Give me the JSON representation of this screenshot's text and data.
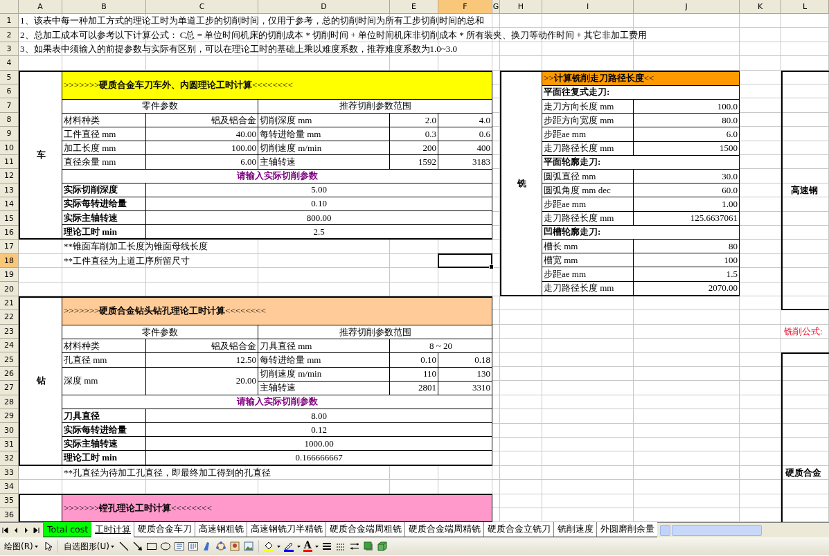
{
  "columns": [
    {
      "label": "A",
      "selected": false
    },
    {
      "label": "B",
      "selected": false
    },
    {
      "label": "C",
      "selected": false
    },
    {
      "label": "D",
      "selected": false
    },
    {
      "label": "E",
      "selected": false
    },
    {
      "label": "F",
      "selected": true
    },
    {
      "label": "G",
      "selected": false
    },
    {
      "label": "H",
      "selected": false
    },
    {
      "label": "I",
      "selected": false
    },
    {
      "label": "J",
      "selected": false
    },
    {
      "label": "K",
      "selected": false
    },
    {
      "label": "L",
      "selected": false
    }
  ],
  "row_numbers": [
    {
      "label": "1",
      "selected": false
    },
    {
      "label": "2",
      "selected": false
    },
    {
      "label": "3",
      "selected": false
    },
    {
      "label": "4",
      "selected": false
    },
    {
      "label": "5",
      "selected": false
    },
    {
      "label": "6",
      "selected": false
    },
    {
      "label": "7",
      "selected": false
    },
    {
      "label": "8",
      "selected": false
    },
    {
      "label": "9",
      "selected": false
    },
    {
      "label": "10",
      "selected": false
    },
    {
      "label": "11",
      "selected": false
    },
    {
      "label": "12",
      "selected": false
    },
    {
      "label": "13",
      "selected": false
    },
    {
      "label": "14",
      "selected": false
    },
    {
      "label": "15",
      "selected": false
    },
    {
      "label": "16",
      "selected": false
    },
    {
      "label": "17",
      "selected": false
    },
    {
      "label": "18",
      "selected": true
    },
    {
      "label": "19",
      "selected": false
    },
    {
      "label": "20",
      "selected": false
    },
    {
      "label": "21",
      "selected": false
    },
    {
      "label": "22",
      "selected": false
    },
    {
      "label": "23",
      "selected": false
    },
    {
      "label": "24",
      "selected": false
    },
    {
      "label": "25",
      "selected": false
    },
    {
      "label": "26",
      "selected": false
    },
    {
      "label": "27",
      "selected": false
    },
    {
      "label": "28",
      "selected": false
    },
    {
      "label": "29",
      "selected": false
    },
    {
      "label": "30",
      "selected": false
    },
    {
      "label": "31",
      "selected": false
    },
    {
      "label": "32",
      "selected": false
    },
    {
      "label": "33",
      "selected": false
    },
    {
      "label": "34",
      "selected": false
    },
    {
      "label": "35",
      "selected": false
    },
    {
      "label": "36",
      "selected": false
    }
  ],
  "notes": [
    "1、该表中每一种加工方式的理论工时为单道工步的切削时间，仅用于参考，总的切削时间为所有工步切削时间的总和",
    "2、总加工成本可以参考以下计算公式： C总 = 单位时间机床的切削成本 * 切削时间 + 单位时间机床非切削成本 * 所有装夹、换刀等动作时间 + 其它非加工费用",
    "3、如果表中须输入的前提参数与实际有区别，可以在理论工时的基础上乘以难度系数，推荐难度系数为1.0~3.0"
  ],
  "calc_sections": [
    {
      "kind": "turning",
      "label": "车",
      "title": ">>>>>>>**硬质合金车刀车外、内圆理论工时计算**<<<<<<<<",
      "part_header": "零件参数",
      "range_header": "推荐切削参数范围",
      "part_params": [
        {
          "label": "材料种类",
          "value": "铝及铝合金"
        },
        {
          "label": "工件直径 mm",
          "value": "40.00"
        },
        {
          "label": "加工长度 mm",
          "value": "100.00"
        },
        {
          "label": "直径余量 mm",
          "value": "6.00"
        }
      ],
      "range_params": [
        {
          "label": "切削深度 mm",
          "min": "2.0",
          "max": "4.0"
        },
        {
          "label": "每转进给量 mm",
          "min": "0.3",
          "max": "0.6"
        },
        {
          "label": "切削速度 m/min",
          "min": "200",
          "max": "400"
        },
        {
          "label": "主轴转速",
          "min": "1592",
          "max": "3183"
        }
      ],
      "input_header": "请输入实际切削参数",
      "inputs": [
        {
          "label": "实际切削深度",
          "value": "5.00"
        },
        {
          "label": "实际每转进给量",
          "value": "0.10"
        },
        {
          "label": "实际主轴转速",
          "value": "800.00"
        },
        {
          "label": "理论工时 min",
          "value": "2.5"
        }
      ],
      "footnotes": [
        "**锥面车削加工长度为锥面母线长度",
        "**工件直径为上道工序所留尺寸"
      ]
    },
    {
      "kind": "drilling",
      "label": "钻",
      "title": ">>>>>>>**硬质合金钻头钻孔理论工时计算**<<<<<<<<",
      "part_header": "零件参数",
      "range_header": "推荐切削参数范围",
      "part_params": [
        {
          "label": "材料种类",
          "value": "铝及铝合金"
        },
        {
          "label": "孔直径 mm",
          "value": "12.50"
        },
        {
          "label": "深度 mm",
          "value": "20.00"
        }
      ],
      "range_params": [
        {
          "label": "刀具直径 mm",
          "range": "8 ~ 20"
        },
        {
          "label": "每转进给量 mm",
          "min": "0.10",
          "max": "0.18"
        },
        {
          "label": "切削速度 m/min",
          "min": "110",
          "max": "130"
        },
        {
          "label": "主轴转速",
          "min": "2801",
          "max": "3310"
        }
      ],
      "input_header": "请输入实际切削参数",
      "inputs": [
        {
          "label": "刀具直径",
          "value": "8.00"
        },
        {
          "label": "实际每转进给量",
          "value": "0.12"
        },
        {
          "label": "实际主轴转速",
          "value": "1000.00"
        },
        {
          "label": "理论工时 min",
          "value": "0.166666667"
        }
      ],
      "footnotes": [
        "**孔直径为待加工孔直径，即最终加工得到的孔直径"
      ]
    },
    {
      "kind": "boring",
      "title": ">>>>>>>**镗孔理论工时计算**<<<<<<<<"
    }
  ],
  "milling": {
    "label": "铣",
    "title": ">>**计算铣削走刀路径长度**<<",
    "groups": [
      {
        "heading": "平面往复式走刀:",
        "rows": [
          {
            "label": "走刀方向长度 mm",
            "value": "100.0"
          },
          {
            "label": "步距方向宽度 mm",
            "value": "80.0"
          },
          {
            "label": "步距ae mm",
            "value": "6.0"
          },
          {
            "label": "走刀路径长度 mm",
            "value": "1500"
          }
        ]
      },
      {
        "heading": "平面轮廓走刀:",
        "rows": [
          {
            "label": "圆弧直径 mm",
            "value": "30.0"
          },
          {
            "label": "圆弧角度 mm dec",
            "value": "60.0"
          },
          {
            "label": "步距ae mm",
            "value": "1.00"
          },
          {
            "label": "走刀路径长度 mm",
            "value": "125.6637061"
          }
        ]
      },
      {
        "heading": "凹槽轮廓走刀:",
        "rows": [
          {
            "label": "槽长  mm",
            "value": "80"
          },
          {
            "label": "槽宽  mm",
            "value": "100"
          },
          {
            "label": "步距ae mm",
            "value": "1.5"
          },
          {
            "label": "走刀路径长度 mm",
            "value": "2070.00"
          }
        ]
      }
    ]
  },
  "side_boxes": [
    {
      "label": "高速钢"
    },
    {
      "label": "硬质合金"
    }
  ],
  "milling_formula_label": "铣削公式:",
  "sheet_tabs": [
    {
      "label": "Total cost",
      "selected": false,
      "color": "#00ff00"
    },
    {
      "label": "工时计算",
      "selected": true
    },
    {
      "label": "硬质合金车刀",
      "selected": false
    },
    {
      "label": "高速钢粗铣",
      "selected": false
    },
    {
      "label": "高速钢铣刀半精铣",
      "selected": false
    },
    {
      "label": "硬质合金端周粗铣",
      "selected": false
    },
    {
      "label": "硬质合金端周精铣",
      "selected": false
    },
    {
      "label": "硬质合金立铣刀",
      "selected": false
    },
    {
      "label": "铣削速度",
      "selected": false
    },
    {
      "label": "外圆磨削余量",
      "selected": false
    }
  ],
  "draw_toolbar": {
    "draw_menu": "绘图(R)",
    "autoshapes_menu": "自选图形(U)",
    "font_color_glyph": "A"
  }
}
